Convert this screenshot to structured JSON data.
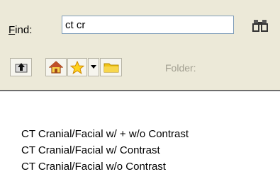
{
  "find": {
    "label_prefix": "F",
    "label_rest": "ind:",
    "value": "ct cr"
  },
  "toolbar": {
    "folder_label": "Folder:",
    "icons": [
      "up-folder-icon",
      "home-icon",
      "star-icon",
      "dropdown-arrow-icon",
      "folder-icon",
      "binoculars-icon"
    ]
  },
  "results": {
    "items": [
      "CT Cranial/Facial w/ + w/o Contrast",
      "CT Cranial/Facial w/ Contrast",
      "CT Cranial/Facial w/o Contrast"
    ]
  }
}
